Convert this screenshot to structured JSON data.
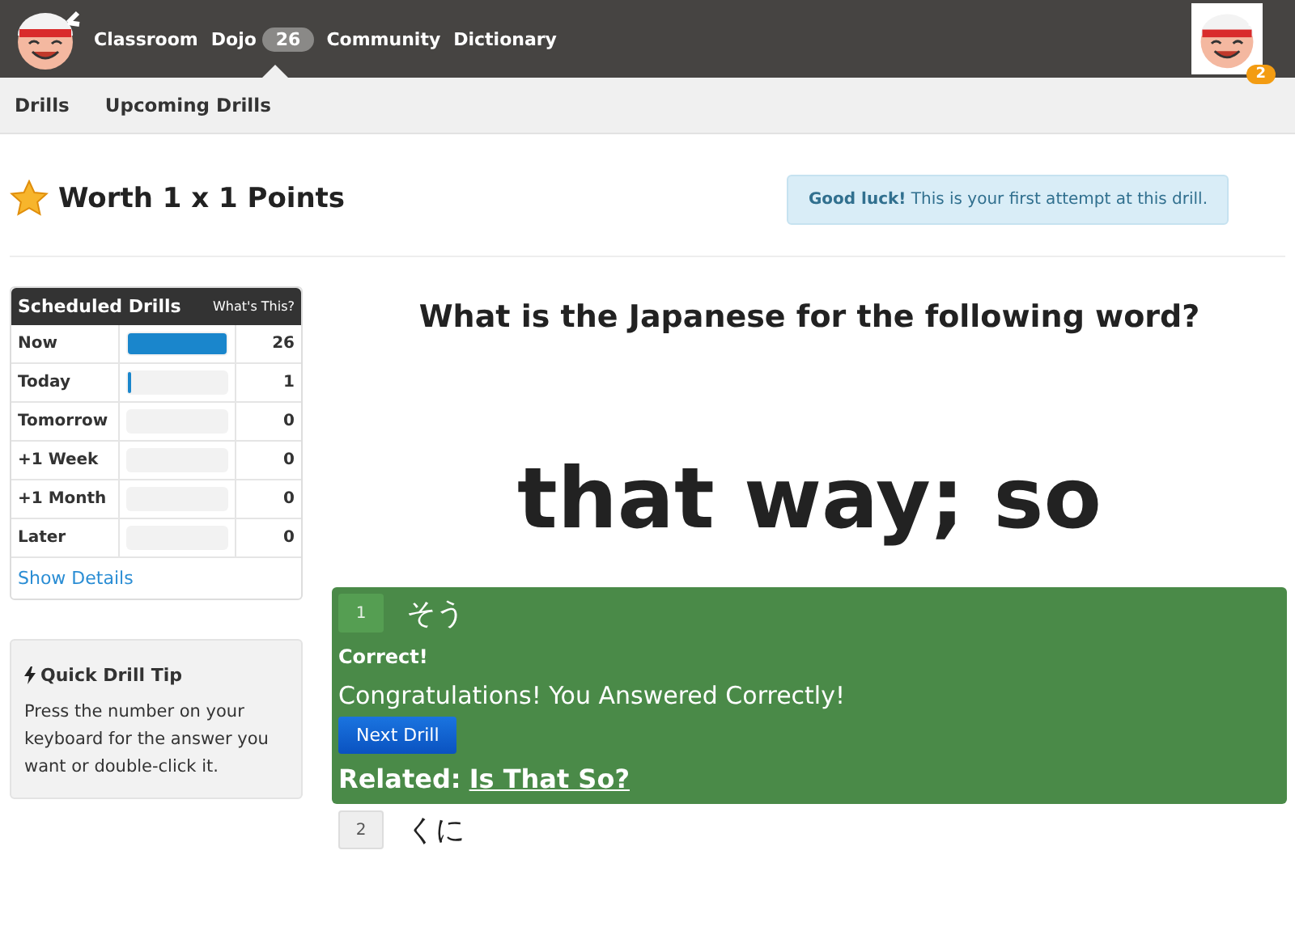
{
  "nav": {
    "items": [
      {
        "label": "Classroom",
        "selected": false
      },
      {
        "label": "Dojo",
        "selected": true,
        "badge": "26"
      },
      {
        "label": "Community",
        "selected": false
      },
      {
        "label": "Dictionary",
        "selected": false
      }
    ],
    "avatar_badge": "2"
  },
  "subnav": {
    "items": [
      {
        "label": "Drills"
      },
      {
        "label": "Upcoming Drills"
      }
    ]
  },
  "worth": "Worth 1 x 1 Points",
  "notice": "**Good luck!** This is your first attempt at this drill.",
  "schedule": {
    "title": "Scheduled Drills",
    "help": "What's This?",
    "rows": [
      {
        "label": "Now",
        "level": 1,
        "count": "26"
      },
      {
        "label": "Today",
        "level": 0.03,
        "count": "1"
      },
      {
        "label": "Tomorrow",
        "level": 0,
        "count": "0"
      },
      {
        "label": "+1 Week",
        "level": 0,
        "count": "0"
      },
      {
        "label": "+1 Month",
        "level": 0,
        "count": "0"
      },
      {
        "label": "Later",
        "level": 0,
        "count": "0"
      }
    ],
    "link": "Show Details"
  },
  "tip": {
    "title": "Quick Drill Tip",
    "text": "Press the number on your keyboard for the answer you want or double-click it."
  },
  "question": "What is the Japanese for the following word?",
  "word": "that way; so",
  "answers": [
    {
      "number": "1",
      "text": "そう",
      "correct": true,
      "status": "Correct!",
      "message": "Congratulations! You Answered Correctly!",
      "button": "Next Drill",
      "related_label": "Related:",
      "related_link": "Is That So?"
    },
    {
      "number": "2",
      "text": "くに",
      "correct": false
    }
  ]
}
